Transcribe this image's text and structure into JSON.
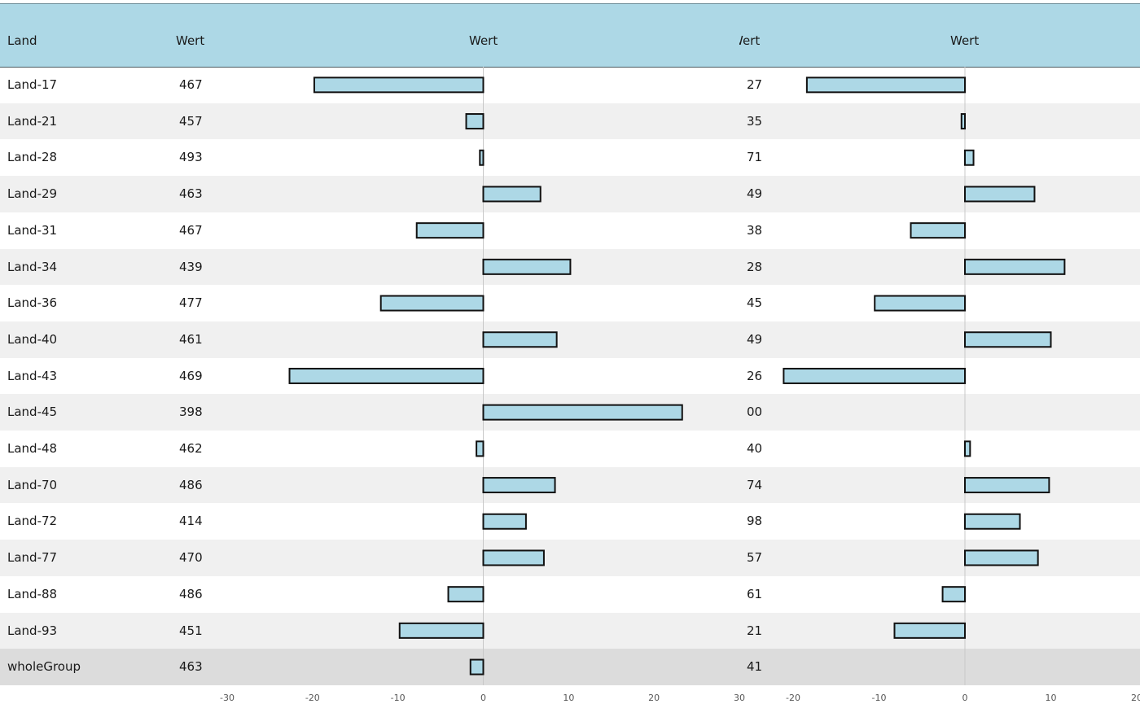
{
  "header": {
    "land": "Land",
    "wert": "Wert",
    "chart1_title": "Wert",
    "wert2": "Wert",
    "chart2_title": "Wert"
  },
  "rows": [
    {
      "land": "Land-17",
      "wert": "467",
      "wert2": "27"
    },
    {
      "land": "Land-21",
      "wert": "457",
      "wert2": "35"
    },
    {
      "land": "Land-28",
      "wert": "493",
      "wert2": "71"
    },
    {
      "land": "Land-29",
      "wert": "463",
      "wert2": "49"
    },
    {
      "land": "Land-31",
      "wert": "467",
      "wert2": "38"
    },
    {
      "land": "Land-34",
      "wert": "439",
      "wert2": "28"
    },
    {
      "land": "Land-36",
      "wert": "477",
      "wert2": "45"
    },
    {
      "land": "Land-40",
      "wert": "461",
      "wert2": "49"
    },
    {
      "land": "Land-43",
      "wert": "469",
      "wert2": "26"
    },
    {
      "land": "Land-45",
      "wert": "398",
      "wert2": "00"
    },
    {
      "land": "Land-48",
      "wert": "462",
      "wert2": "40"
    },
    {
      "land": "Land-70",
      "wert": "486",
      "wert2": "74"
    },
    {
      "land": "Land-72",
      "wert": "414",
      "wert2": "98"
    },
    {
      "land": "Land-77",
      "wert": "470",
      "wert2": "57"
    },
    {
      "land": "Land-88",
      "wert": "486",
      "wert2": "61"
    },
    {
      "land": "Land-93",
      "wert": "451",
      "wert2": "21"
    },
    {
      "land": "wholeGroup",
      "wert": "463",
      "wert2": "41"
    }
  ],
  "colors": {
    "header_bg": "#add8e6",
    "bar_fill": "#add8e6",
    "bar_stroke": "#111111",
    "row_alt": "#f0f0f0",
    "row_total": "#dcdcdc"
  },
  "chart_data": [
    {
      "type": "bar",
      "orientation": "horizontal",
      "title": "Wert",
      "categories": [
        "Land-17",
        "Land-21",
        "Land-28",
        "Land-29",
        "Land-31",
        "Land-34",
        "Land-36",
        "Land-40",
        "Land-43",
        "Land-45",
        "Land-48",
        "Land-70",
        "Land-72",
        "Land-77",
        "Land-88",
        "Land-93",
        "wholeGroup"
      ],
      "values": [
        -19.8,
        -2.0,
        -0.4,
        6.7,
        -7.8,
        10.2,
        -12.0,
        8.6,
        -22.7,
        23.3,
        -0.8,
        8.4,
        5.0,
        7.1,
        -4.1,
        -9.8,
        -1.5
      ],
      "xlim": [
        -30,
        30
      ],
      "xticks": [
        "-30",
        "-20",
        "-10",
        "0",
        "10",
        "20",
        "30"
      ]
    },
    {
      "type": "bar",
      "orientation": "horizontal",
      "title": "Wert",
      "categories": [
        "Land-17",
        "Land-21",
        "Land-28",
        "Land-29",
        "Land-31",
        "Land-34",
        "Land-36",
        "Land-40",
        "Land-43",
        "Land-45",
        "Land-48",
        "Land-70",
        "Land-72",
        "Land-77",
        "Land-88",
        "Land-93",
        "wholeGroup"
      ],
      "values": [
        -18.4,
        -0.4,
        1.0,
        8.1,
        -6.3,
        11.6,
        -10.5,
        10.0,
        -21.1,
        0,
        0.6,
        9.8,
        6.4,
        8.5,
        -2.6,
        -8.2,
        0
      ],
      "xlim": [
        -20,
        20
      ],
      "xticks": [
        "-20",
        "-10",
        "0",
        "10",
        "20"
      ]
    }
  ]
}
